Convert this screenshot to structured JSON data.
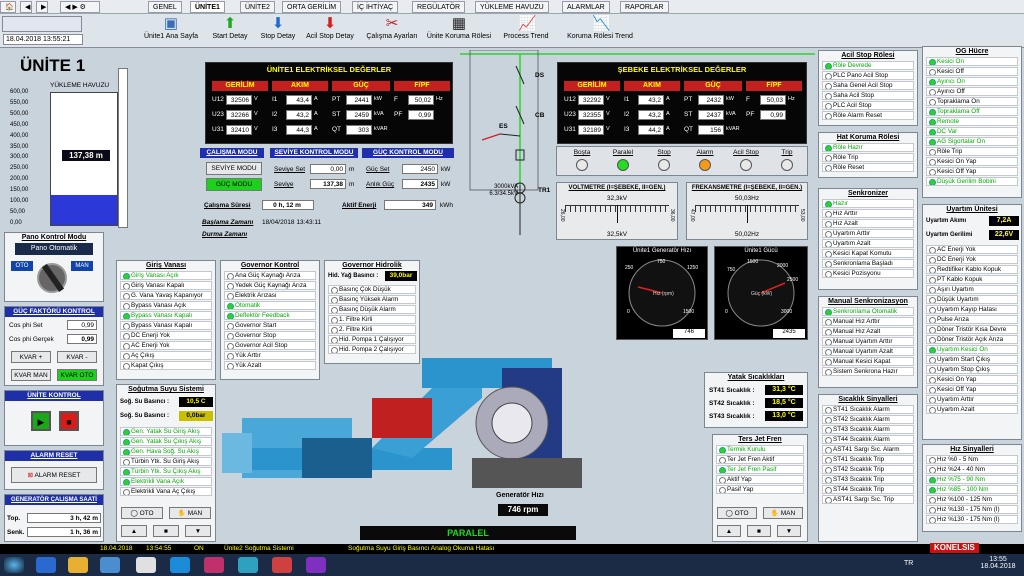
{
  "tabs": [
    "GENEL",
    "ÜNİTE1",
    "ÜNİTE2",
    "ORTA GERİLİM",
    "İÇ İHTİYAÇ",
    "REGÜLATÖR",
    "YÜKLEME HAVUZU",
    "ALARMLAR",
    "RAPORLAR"
  ],
  "datetime": "18.04.2018     13:55:21",
  "toolbar": [
    "Ünite1 Ana Sayfa",
    "Start Detay",
    "Stop Detay",
    "Acil Stop Detay",
    "Çalışma Ayarları",
    "Ünite Koruma Rölesi",
    "Process Trend",
    "Koruma Rölesi Trend"
  ],
  "unit_title": "ÜNİTE 1",
  "reservoir": {
    "title": "YÜKLEME HAVUZU",
    "ticks": [
      "600,00",
      "550,00",
      "500,00",
      "450,00",
      "400,00",
      "350,00",
      "300,00",
      "250,00",
      "200,00",
      "150,00",
      "100,00",
      "50,00",
      "0,00"
    ],
    "value": "137,38 m",
    "level_fraction": 0.229
  },
  "electrical": {
    "title": "ÜNİTE1 ELEKTRİKSEL DEĞERLER",
    "headers": [
      "GERİLİM",
      "AKIM",
      "GÜÇ",
      "F/PF"
    ],
    "v": [
      [
        "U12",
        "32506",
        "V"
      ],
      [
        "U23",
        "32266",
        "V"
      ],
      [
        "U31",
        "32410",
        "V"
      ]
    ],
    "a": [
      [
        "I1",
        "43,4",
        "A"
      ],
      [
        "I2",
        "43,2",
        "A"
      ],
      [
        "I3",
        "44,3",
        "A"
      ]
    ],
    "p": [
      [
        "PT",
        "2441",
        "kW"
      ],
      [
        "ST",
        "2459",
        "kVA"
      ],
      [
        "QT",
        "303",
        "kVAR"
      ]
    ],
    "f": [
      [
        "F",
        "50,02",
        "Hz"
      ],
      [
        "PF",
        "0,99",
        ""
      ]
    ]
  },
  "grid": {
    "title": "ŞEBEKE ELEKTRİKSEL DEĞERLER",
    "headers": [
      "GERİLİM",
      "AKIM",
      "GÜÇ",
      "F/PF"
    ],
    "v": [
      [
        "U12",
        "32292",
        "V"
      ],
      [
        "U23",
        "32355",
        "V"
      ],
      [
        "U31",
        "32189",
        "V"
      ]
    ],
    "a": [
      [
        "I1",
        "43,2",
        "A"
      ],
      [
        "I2",
        "43,2",
        "A"
      ],
      [
        "I3",
        "44,2",
        "A"
      ]
    ],
    "p": [
      [
        "PT",
        "2432",
        "kW"
      ],
      [
        "ST",
        "2437",
        "kVA"
      ],
      [
        "QT",
        "156",
        "kVAR"
      ]
    ],
    "f": [
      [
        "F",
        "50,03",
        "Hz"
      ],
      [
        "PF",
        "0,99",
        ""
      ]
    ]
  },
  "modes": {
    "h1": "ÇALIŞMA MODU",
    "h2": "SEVİYE KONTROL MODU",
    "h3": "GÜÇ KONTROL MODU",
    "b1": "SEVİYE MODU",
    "b2": "GÜÇ MODU",
    "set_lbl": "Seviye Set",
    "set_val": "0,00",
    "set_unit": "m",
    "lvl_lbl": "Seviye",
    "lvl_val": "137,38",
    "lvl_unit": "m",
    "gset_lbl": "Güç Set",
    "gset_val": "2450",
    "gset_unit": "kW",
    "ag_lbl": "Anlık Güç",
    "ag_val": "2435",
    "ag_unit": "kW",
    "cs_lbl": "Çalışma Süresi",
    "cs_val": "0 h, 12 m",
    "ae_lbl": "Aktif Enerji",
    "ae_val": "349",
    "ae_unit": "kWh"
  },
  "times": {
    "b_lbl": "Başlama Zamanı",
    "b_val": "18/04/2018  13:43:11",
    "d_lbl": "Durma Zamanı"
  },
  "sld": {
    "ds": "DS",
    "es": "ES",
    "cb": "CB",
    "tr": "TR1",
    "trinfo": "3000kVA 6.3/34.5kV"
  },
  "status": [
    {
      "l": "Boşta",
      "c": "#e8e8e8"
    },
    {
      "l": "Paralel",
      "c": "#22dd22"
    },
    {
      "l": "Stop",
      "c": "#e8e8e8"
    },
    {
      "l": "Alarm",
      "c": "#f39a1b"
    },
    {
      "l": "Acil Stop",
      "c": "#e8e8e8"
    },
    {
      "l": "Trip",
      "c": "#e8e8e8"
    }
  ],
  "voltmeter": {
    "title": "VOLTMETRE (I=ŞEBEKE, II=GEN.)",
    "top": "32,3kV",
    "bot": "32,5kV",
    "l": "26,00",
    "r": "36,00",
    "m": "31,00"
  },
  "freqmeter": {
    "title": "FREKANSMETRE (I=ŞEBEKE, II=GEN.)",
    "top": "50,03Hz",
    "bot": "50,02Hz",
    "l": "47,00",
    "r": "53,00",
    "m": "50,00"
  },
  "gauge1": {
    "title": "Ünite1 Generatör Hızı",
    "unit": "Hız (rpm)",
    "ticks": [
      "0",
      "250",
      "500",
      "750",
      "1000",
      "1250",
      "1500"
    ],
    "val": "746"
  },
  "gauge2": {
    "title": "Ünite1 Gücü",
    "unit": "Güç (kW)",
    "ticks": [
      "0",
      "500",
      "750",
      "1000",
      "1500",
      "2000",
      "2500",
      "3000"
    ],
    "val": "2435"
  },
  "pano": {
    "title": "Pano Kontrol Modu",
    "disp": "Pano Otomatik",
    "oto": "OTO",
    "man": "MAN"
  },
  "gfk": {
    "title": "GÜÇ FAKTÖRÜ KONTROL",
    "set_lbl": "Cos phi Set",
    "set_val": "0,99",
    "act_lbl": "Cos phi Gerçek",
    "act_val": "0,99",
    "kp": "KVAR +",
    "km": "KVAR -",
    "kman": "KVAR MAN",
    "koto": "KVAR OTO"
  },
  "uk": {
    "title": "ÜNİTE KONTROL"
  },
  "ar": {
    "title": "ALARM RESET",
    "btn": "ALARM RESET"
  },
  "gcs": {
    "title": "GENERATÖR ÇALIŞMA SAATİ",
    "top_l": "Top.",
    "top_v": "3 h, 42 m",
    "senk_l": "Senk.",
    "senk_v": "1 h, 36 m"
  },
  "giris": {
    "title": "Giriş Vanası",
    "items": [
      [
        "Giriş Vanası Açık",
        1
      ],
      [
        "Giriş Vanası Kapalı",
        0
      ],
      [
        "G. Vana Yavaş Kapanıyor",
        0
      ],
      [
        "Bypass Vanası Açık",
        0
      ],
      [
        "Bypass Vanası Kapalı",
        1
      ],
      [
        "Bypass Vanası Kapalı",
        0
      ],
      [
        "DC Enerji Yok",
        0
      ],
      [
        "AC Enerji Yok",
        0
      ],
      [
        "Aç Çıkış",
        0
      ],
      [
        "Kapat Çıkış",
        0
      ]
    ]
  },
  "gov": {
    "title": "Governor Kontrol",
    "items": [
      [
        "Ana Güç Kaynağı Arıza",
        0
      ],
      [
        "Yedek Güç Kaynağı Arıza",
        0
      ],
      [
        "Elektrik Arızası",
        0
      ],
      [
        "Otomatik",
        1
      ],
      [
        "Deflektör Feedback",
        1
      ],
      [
        "Governor Start",
        0
      ],
      [
        "Governor Stop",
        0
      ],
      [
        "Governor Acil Stop",
        0
      ],
      [
        "Yük Arttır",
        0
      ],
      [
        "Yük Azalt",
        0
      ]
    ]
  },
  "gh": {
    "title": "Governor Hidrolik",
    "bas_lbl": "Hid. Yağ Basıncı :",
    "bas_val": "39,0bar",
    "items": [
      [
        "Basınç Çok Düşük",
        0
      ],
      [
        "Basınç Yüksek Alarm",
        0
      ],
      [
        "Basınç Düşük Alarm",
        0
      ],
      [
        "1. Filtre Kirli",
        0
      ],
      [
        "2. Filtre Kirli",
        0
      ],
      [
        "Hid. Pompa 1 Çalışıyor",
        0
      ],
      [
        "Hid. Pompa 2 Çalışıyor",
        0
      ]
    ]
  },
  "sogutma": {
    "title": "Soğutma Suyu Sistemi",
    "b_lbl": "Soğ. Su Basıncı :",
    "b_val": "10,5 C",
    "s_lbl": "Soğ. Su Basıncı :",
    "s_val": "0,0bar",
    "items": [
      [
        "Gen. Yatak Su Giriş Akış",
        1
      ],
      [
        "Gen. Yatak Su Çıkış Akış",
        1
      ],
      [
        "Gen. Hava Soğ. Su Akış",
        1
      ],
      [
        "Türbin Ytk. Su Giriş Akış",
        0
      ],
      [
        "Türbin Ytk. Su Çıkış Akış",
        1
      ],
      [
        "Elektrikli Vana Açık",
        1
      ],
      [
        "Elektrikli Vana Aç Çıkış",
        0
      ]
    ],
    "oto": "OTO",
    "man": "MAN"
  },
  "gen_speed": {
    "lbl": "Generatör Hızı",
    "val": "746 rpm"
  },
  "paralel": "PARALEL",
  "acil": {
    "title": "Acil Stop Rölesi",
    "items": [
      [
        "Röle Devrede",
        1
      ],
      [
        "PLC Pano Acil Stop",
        0
      ],
      [
        "Saha Genel Acil Stop",
        0
      ],
      [
        "Saha Acil Stop",
        0
      ],
      [
        "PLC Acil Stop",
        0
      ],
      [
        "Röle Alarm Reset",
        0
      ]
    ]
  },
  "hat": {
    "title": "Hat Koruma Rölesi",
    "items": [
      [
        "Röle Hazır",
        1
      ],
      [
        "Röle Trip",
        0
      ],
      [
        "Röle Reset",
        0
      ]
    ]
  },
  "senk": {
    "title": "Senkronizer",
    "items": [
      [
        "Hazır",
        1
      ],
      [
        "Hız Arttır",
        0
      ],
      [
        "Hız Azalt",
        0
      ],
      [
        "Uyartım Arttır",
        0
      ],
      [
        "Uyartım Azalt",
        0
      ],
      [
        "Kesici Kapat Komutu",
        0
      ],
      [
        "Senkronlama Başladı",
        0
      ],
      [
        "Kesici Pozisyonu",
        0
      ]
    ]
  },
  "ms": {
    "title": "Manual Senkronizasyon",
    "items": [
      [
        "Senkronlama Otomatik",
        1
      ],
      [
        "Manual Hız Arttır",
        0
      ],
      [
        "Manual Hız Azalt",
        0
      ],
      [
        "Manual Uyartım Arttır",
        0
      ],
      [
        "Manual Uyartım Azalt",
        0
      ],
      [
        "Manual Kesici Kapat",
        0
      ],
      [
        "Sistem Senkrona Hazır",
        0
      ]
    ]
  },
  "ys": {
    "title": "Yatak Sıcaklıkları",
    "items": [
      [
        "ST41 Sıcaklık :",
        "31,3 °C"
      ],
      [
        "ST42 Sıcaklık :",
        "18,5 °C"
      ],
      [
        "ST43 Sıcaklık :",
        "13,0 °C"
      ]
    ]
  },
  "ss": {
    "title": "Sıcaklık Sinyalleri",
    "items": [
      [
        "ST41 Sıcaklık Alarm",
        0
      ],
      [
        "ST42 Sıcaklık Alarm",
        0
      ],
      [
        "ST43 Sıcaklık Alarm",
        0
      ],
      [
        "ST44 Sıcaklık Alarm",
        0
      ],
      [
        "AST41 Sargı Sıc. Alarm",
        0
      ],
      [
        "ST41 Sıcaklık Trip",
        0
      ],
      [
        "ST42 Sıcaklık Trip",
        0
      ],
      [
        "ST43 Sıcaklık Trip",
        0
      ],
      [
        "ST44 Sıcaklık Trip",
        0
      ],
      [
        "AST41 Sargı Sıc. Trip",
        0
      ]
    ]
  },
  "tjf": {
    "title": "Ters Jet Fren",
    "items": [
      [
        "Termik Kurulu",
        1
      ],
      [
        "Ter Jet Fren Aktif",
        0
      ],
      [
        "Ter Jet Fren Pasif",
        1
      ],
      [
        "Aktif Yap",
        0
      ],
      [
        "Pasif Yap",
        0
      ]
    ],
    "oto": "OTO",
    "man": "MAN"
  },
  "og": {
    "title": "OG Hücre",
    "items": [
      [
        "Kesici On",
        1
      ],
      [
        "Kesici Off",
        0
      ],
      [
        "Ayırıcı On",
        1
      ],
      [
        "Ayırıcı Off",
        0
      ],
      [
        "Topraklama On",
        0
      ],
      [
        "Topraklama Off",
        1
      ],
      [
        "Remote",
        1
      ],
      [
        "DC Var",
        1
      ],
      [
        "AG Sigortalar On",
        1
      ],
      [
        "Röle Trip",
        0
      ],
      [
        "Kesici On Yap",
        0
      ],
      [
        "Kesici Off Yap",
        0
      ],
      [
        "Düşük Gerilim Bobini",
        1
      ]
    ]
  },
  "uy": {
    "title": "Uyartım Ünitesi",
    "ak_lbl": "Uyartım Akımı",
    "ak_val": "7,2A",
    "ge_lbl": "Uyartım Gerilimi",
    "ge_val": "22,6V",
    "items": [
      [
        "AC Enerji Yok",
        0
      ],
      [
        "DC Enerji Yok",
        0
      ],
      [
        "Redtifiker Kablo Kopuk",
        0
      ],
      [
        "PT Kablo Kopuk",
        0
      ],
      [
        "Aşırı Uyartım",
        0
      ],
      [
        "Düşük Uyartım",
        0
      ],
      [
        "Uyartım Kayıp Hatası",
        0
      ],
      [
        "Pulse Arıza",
        0
      ],
      [
        "Döner Tristör Kısa Devre",
        0
      ],
      [
        "Döner Tristör Açık Arıza",
        0
      ],
      [
        "Uyartım Kesici On",
        1
      ],
      [
        "Uyartım Start Çıkış",
        0
      ],
      [
        "Uyartım Stop Çıkış",
        0
      ],
      [
        "Kesici On Yap",
        0
      ],
      [
        "Kesici Off Yap",
        0
      ],
      [
        "Uyartım Arttır",
        0
      ],
      [
        "Uyartım Azalt",
        0
      ]
    ]
  },
  "hz": {
    "title": "Hız Sinyalleri",
    "items": [
      [
        "Hız %0 - 5  Nm",
        0
      ],
      [
        "Hız %24 - 40 Nm",
        0
      ],
      [
        "Hız %75 - 90 Nm",
        1
      ],
      [
        "Hız %85 - 100 Nm",
        1
      ],
      [
        "Hız %100 - 125 Nm",
        0
      ],
      [
        "Hız %130 - 175 Nm (I)",
        0
      ],
      [
        "Hız %130 - 175 Nm (I)",
        0
      ]
    ]
  },
  "statusbar": {
    "date": "18.04.2018",
    "time": "13:54:55",
    "state": "ON",
    "sys": "Ünite2 Soğutma Sistemi",
    "msg": "Soğutma Suyu Giriş Basıncı Analog Okuma Hatası"
  },
  "logo": "KONELSIS",
  "tray": {
    "lang": "TR",
    "time": "13:55",
    "date": "18.04.2018"
  }
}
